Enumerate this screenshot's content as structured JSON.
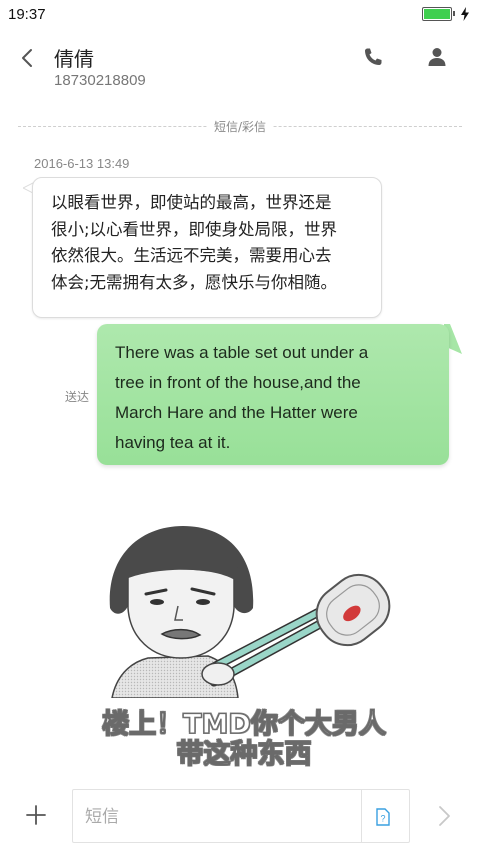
{
  "status_bar": {
    "time": "19:37",
    "battery_color": "#3fcf4f"
  },
  "header": {
    "contact_name": "倩倩",
    "contact_number": "18730218809"
  },
  "conversation": {
    "divider_label": "短信/彩信",
    "received": {
      "timestamp": "2016-6-13 13:49",
      "lines": [
        "以眼看世界，即使站的最高，世界还是",
        "很小;以心看世界，即使身处局限，世界",
        "依然很大。生活远不完美，需要用心去",
        "体会;无需拥有太多，愿快乐与你相随。"
      ]
    },
    "sent": {
      "status": "送达",
      "lines": [
        "There was a table set out under a",
        "tree in front of the house,and the",
        "March Hare and the Hatter were",
        "having tea at it."
      ],
      "bubble_color": "#a6e6a6"
    },
    "image_message": {
      "caption_line1": "楼上！TMD你个大男人",
      "caption_line2": "带这种东西"
    }
  },
  "composer": {
    "placeholder": "短信",
    "value": ""
  }
}
